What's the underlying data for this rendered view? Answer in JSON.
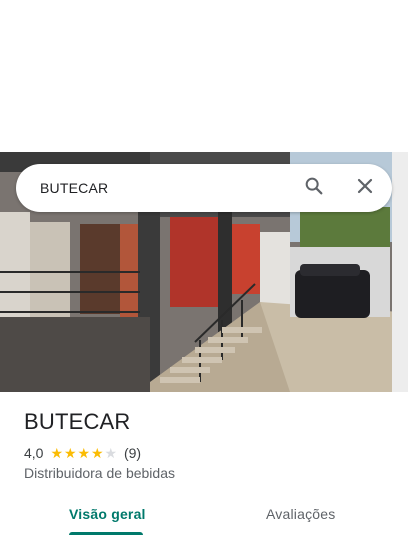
{
  "search": {
    "query": "BUTECAR"
  },
  "place": {
    "name": "BUTECAR",
    "rating": "4,0",
    "rating_value": 4.0,
    "stars_max": 5,
    "review_count": "(9)",
    "category": "Distribuidora de bebidas"
  },
  "tabs": [
    {
      "label": "Visão geral",
      "active": true
    },
    {
      "label": "Avaliações",
      "active": false
    }
  ],
  "colors": {
    "accent": "#00796b",
    "star": "#fbbc04",
    "star_empty": "#dadce0"
  },
  "icons": {
    "search": "search-icon",
    "close": "close-icon"
  }
}
